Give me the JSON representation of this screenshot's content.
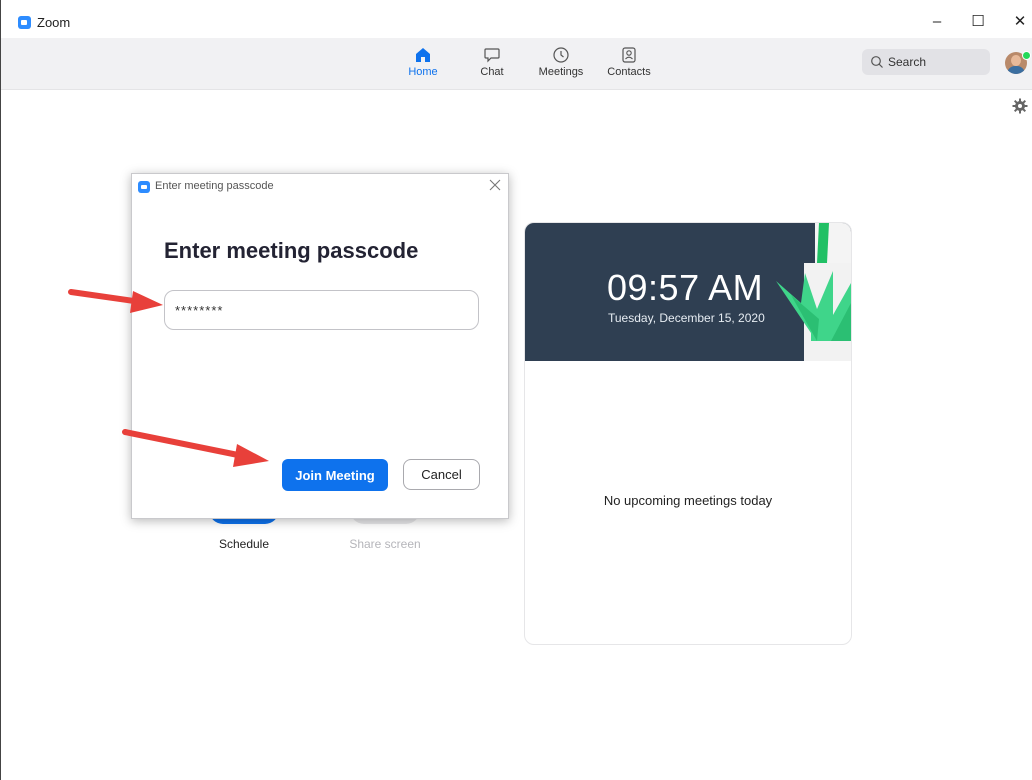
{
  "window": {
    "title": "Zoom",
    "controls": {
      "minimize": "–",
      "maximize": "☐",
      "close": "✕"
    }
  },
  "nav": {
    "tabs": [
      {
        "label": "Home",
        "icon": "home-icon",
        "active": true
      },
      {
        "label": "Chat",
        "icon": "chat-icon",
        "active": false
      },
      {
        "label": "Meetings",
        "icon": "clock-icon",
        "active": false
      },
      {
        "label": "Contacts",
        "icon": "contacts-icon",
        "active": false
      }
    ],
    "search_label": "Search"
  },
  "home": {
    "actions": [
      {
        "label": "Schedule",
        "enabled": true
      },
      {
        "label": "Share screen",
        "enabled": false
      }
    ]
  },
  "meeting_card": {
    "time": "09:57 AM",
    "date": "Tuesday, December 15, 2020",
    "empty_state": "No upcoming meetings today"
  },
  "dialog": {
    "window_title": "Enter meeting passcode",
    "heading": "Enter meeting passcode",
    "passcode_value": "********",
    "join_label": "Join Meeting",
    "cancel_label": "Cancel"
  },
  "colors": {
    "accent": "#0e72ed",
    "annotation_arrow": "#e8403a",
    "card_header": "#2f3f52",
    "presence": "#23d959"
  }
}
